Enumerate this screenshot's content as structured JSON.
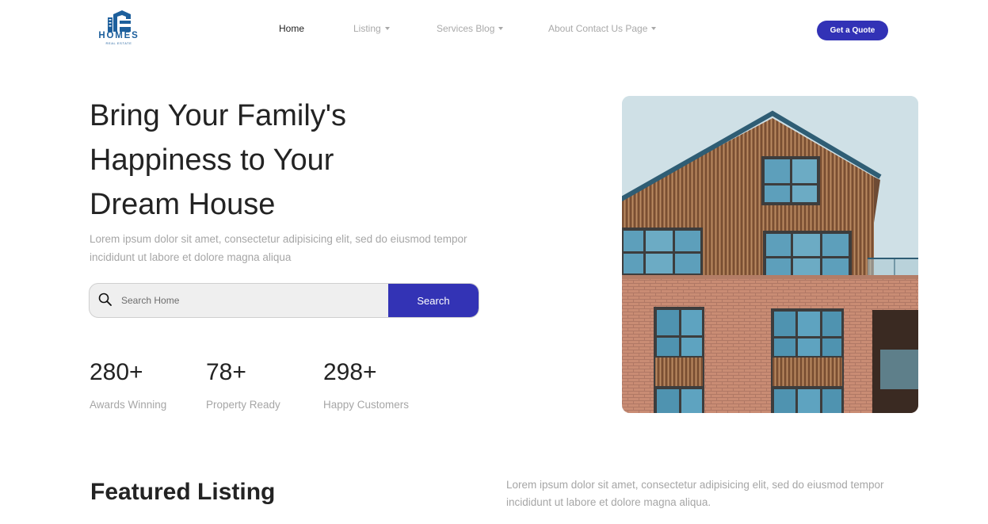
{
  "brand": {
    "name": "HOMES",
    "tagline": "REAL ESTATE"
  },
  "nav": [
    {
      "label": "Home",
      "active": true,
      "dropdown": false
    },
    {
      "label": "Listing",
      "active": false,
      "dropdown": true
    },
    {
      "label": "Services Blog",
      "active": false,
      "dropdown": true
    },
    {
      "label": "About Contact Us Page",
      "active": false,
      "dropdown": true
    }
  ],
  "header": {
    "cta_label": "Get a Quote"
  },
  "hero": {
    "title_lines": [
      "Bring Your Family's",
      "Happiness to Your",
      "Dream House"
    ],
    "description": "Lorem ipsum dolor sit amet, consectetur adipisicing elit, sed do eiusmod tempor incididunt ut labore et dolore magna aliqua",
    "search": {
      "placeholder": "Search Home",
      "button_label": "Search"
    }
  },
  "stats": [
    {
      "value": "280+",
      "label": "Awards Winning"
    },
    {
      "value": "78+",
      "label": "Property Ready"
    },
    {
      "value": "298+",
      "label": "Happy Customers"
    }
  ],
  "featured": {
    "title": "Featured Listing",
    "description": "Lorem ipsum dolor sit amet, consectetur adipisicing elit, sed do eiusmod tempor incididunt ut labore et dolore magna aliqua."
  },
  "colors": {
    "accent": "#3333b5",
    "brand": "#1d5f9c",
    "muted_text": "#a6a6a6"
  },
  "icons": {
    "search": "search-icon",
    "dropdown": "caret-down-icon"
  }
}
